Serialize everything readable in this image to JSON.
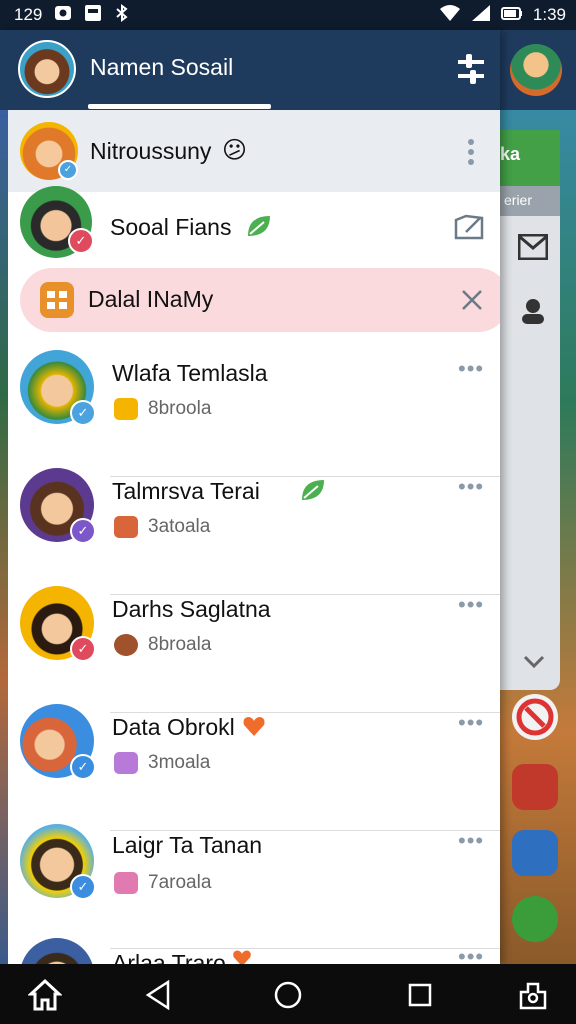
{
  "status_bar": {
    "left_text": "129",
    "time": "1:39",
    "icons": [
      "photo-icon",
      "message-icon",
      "bluetooth-icon",
      "wifi-icon",
      "signal-icon",
      "battery-icon"
    ]
  },
  "drawer": {
    "title": "Namen Sosail",
    "header_action_icon": "tune-icon",
    "pinned_item": {
      "name": "Nitroussuny",
      "emoji": "😕",
      "menu_icon": "more-vert-icon"
    },
    "suggestion_item": {
      "name": "Sooal Fians",
      "emoji_icon": "leaf-icon",
      "action_icon": "edit-icon"
    },
    "banner_item": {
      "name": "Dalal INaMy",
      "close_icon": "close-icon"
    },
    "list": [
      {
        "name": "Wlafa Temlasla",
        "sub": "8broola",
        "badge": "✓",
        "badge_color": "#4aa3df",
        "emoji": ""
      },
      {
        "name": "Talmrsva Terai",
        "sub": "3atoala",
        "badge": "✓",
        "badge_color": "#7b57c9",
        "emoji": "leaf"
      },
      {
        "name": "Darhs Saglatna",
        "sub": "8broala",
        "badge": "✓",
        "badge_color": "#e04a5f",
        "emoji": ""
      },
      {
        "name": "Data Obrokl",
        "sub": "3moala",
        "badge": "✓",
        "badge_color": "#3b8de0",
        "emoji": "heart"
      },
      {
        "name": "Laigr Ta Tanan",
        "sub": "7aroala",
        "badge": "✓",
        "badge_color": "#3b8de0",
        "emoji": ""
      },
      {
        "name": "Arlaa Traro",
        "sub": "",
        "badge": "",
        "badge_color": "#3b8de0",
        "emoji": "heart"
      }
    ]
  },
  "background_app": {
    "panel_title": "ka",
    "panel_sub": "erier"
  },
  "nav_bar": {
    "buttons": [
      "home-icon",
      "back-icon",
      "home-circle-icon",
      "recents-icon",
      "settings-icon"
    ]
  },
  "colors": {
    "header": "#1e3b5e",
    "highlight": "#fadadd",
    "accent_green": "#43a047"
  }
}
